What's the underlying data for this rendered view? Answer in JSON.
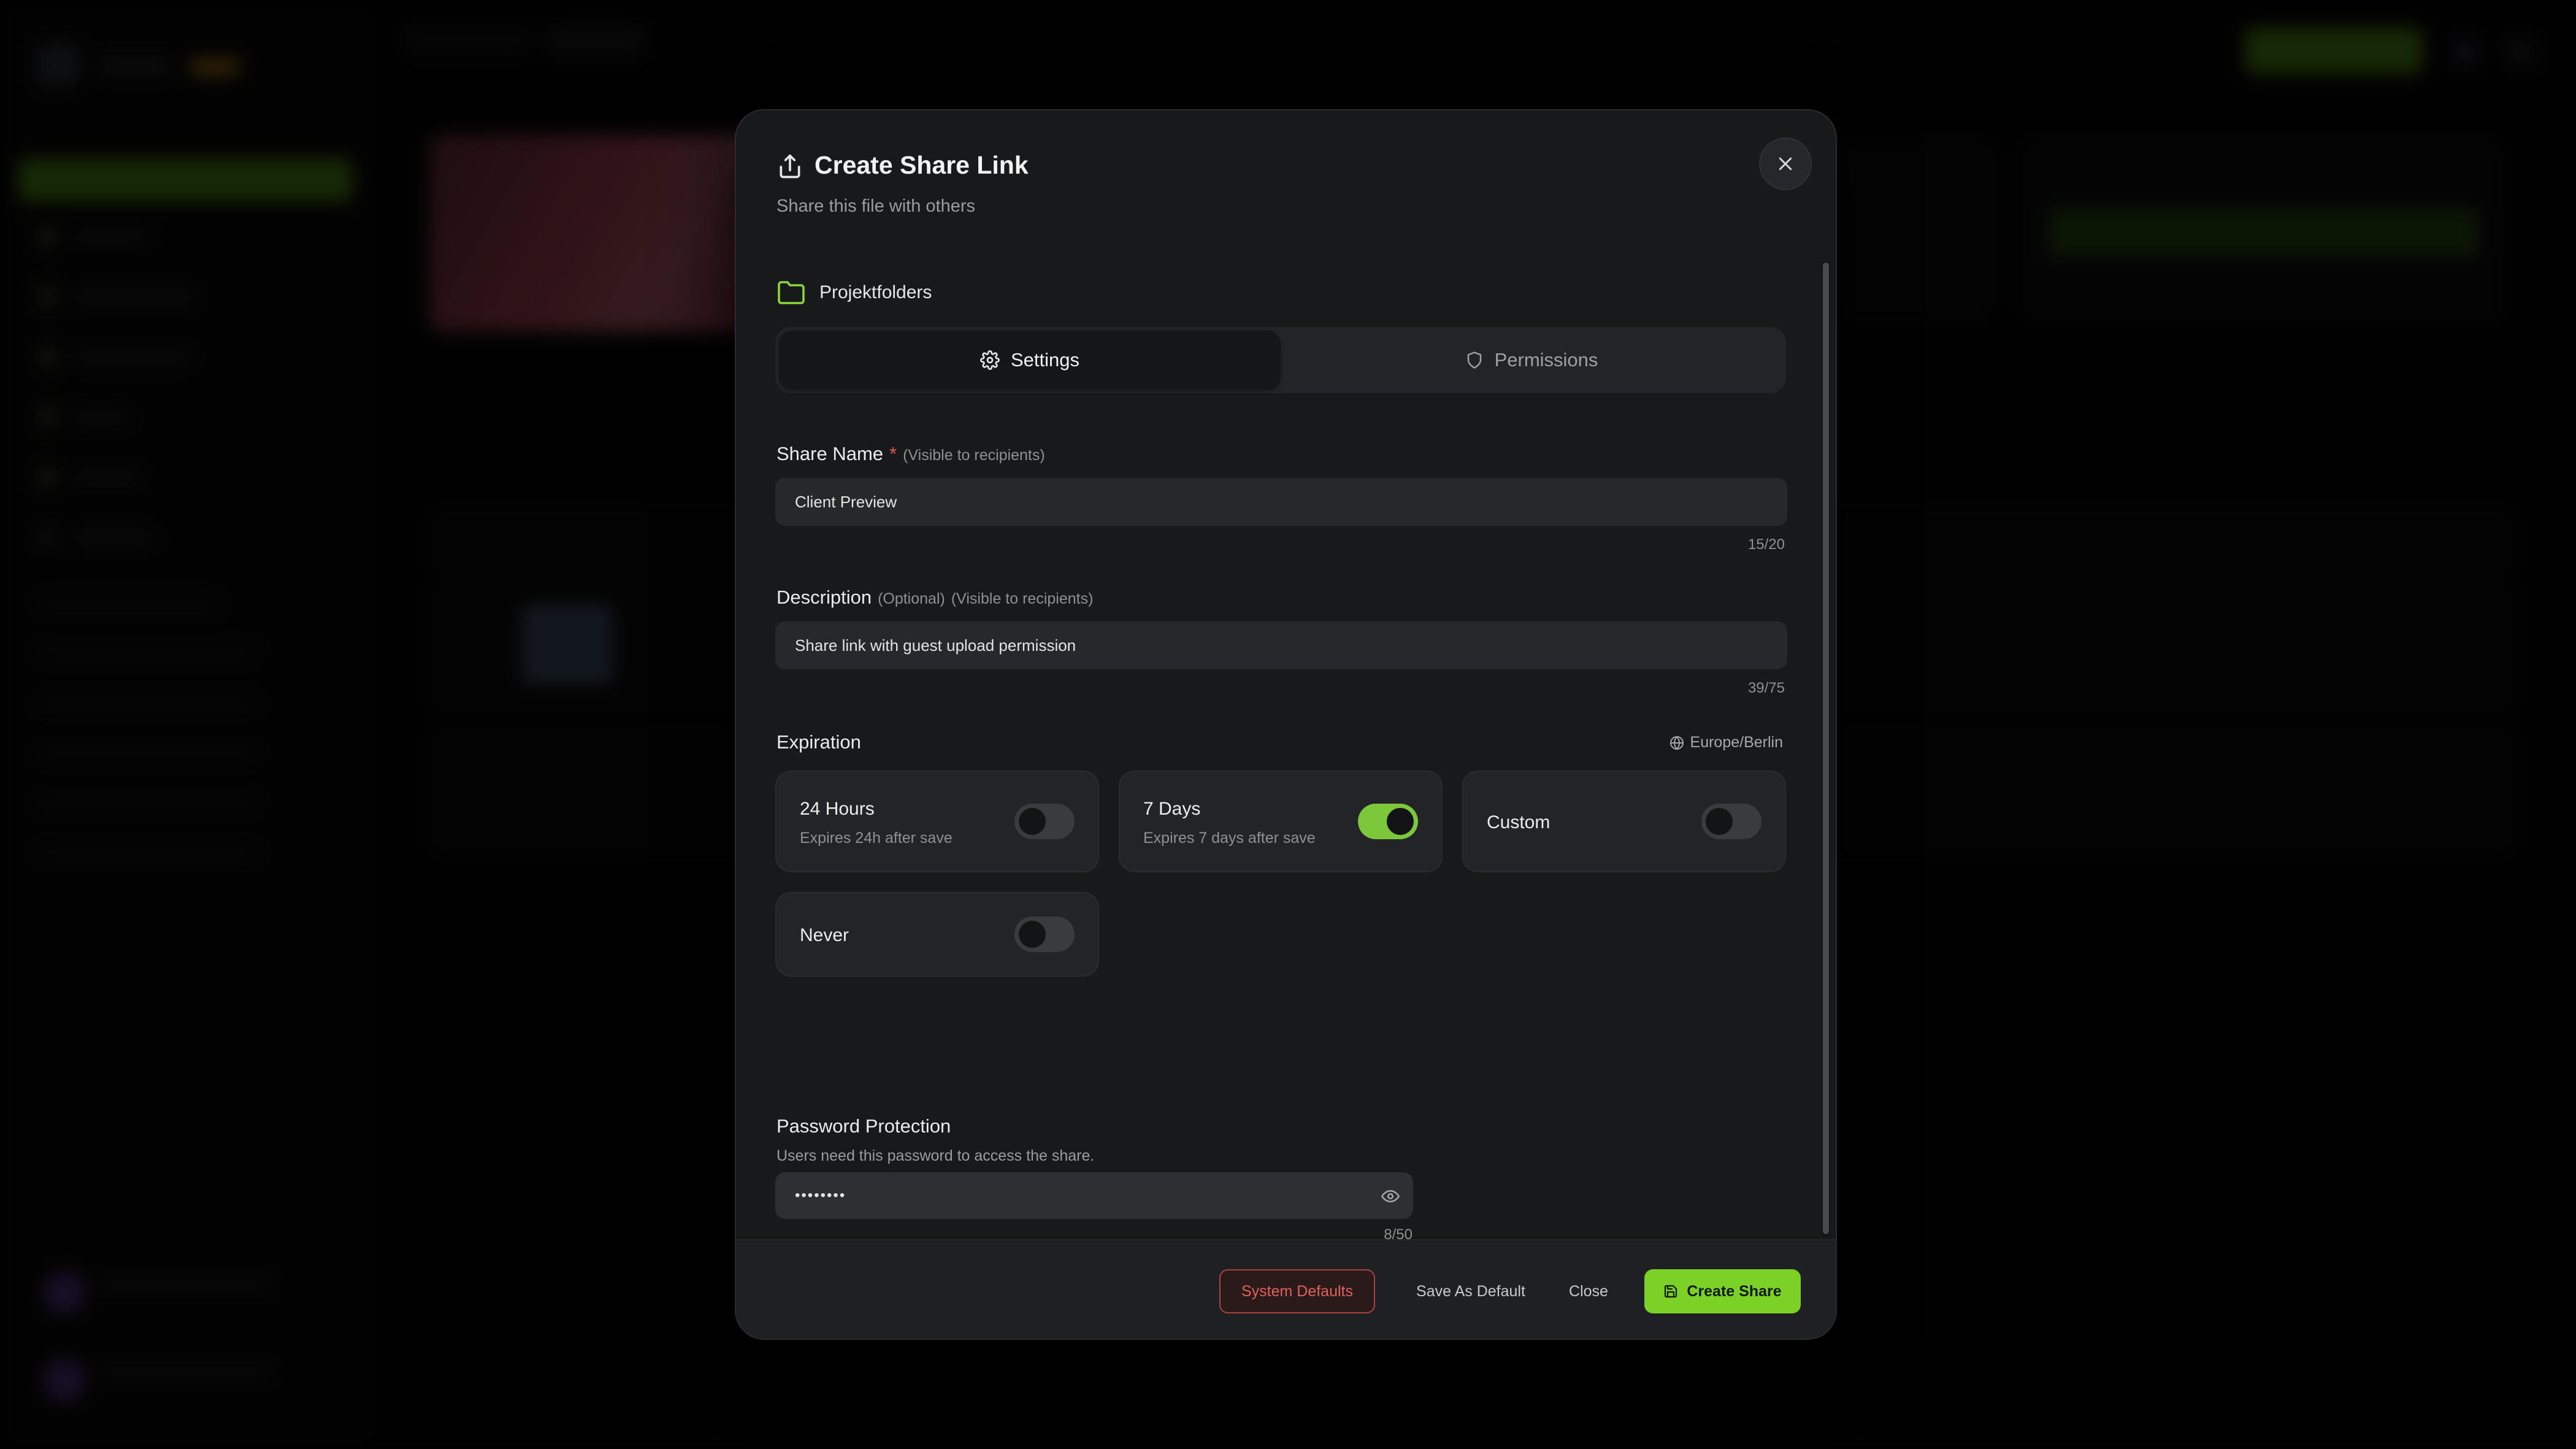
{
  "modal": {
    "title": "Create Share Link",
    "subtitle": "Share this file with others",
    "folder_name": "Projektfolders",
    "tabs": [
      {
        "label": "Settings",
        "icon": "gear-icon",
        "active": true
      },
      {
        "label": "Permissions",
        "icon": "shield-icon",
        "active": false
      }
    ],
    "share_name": {
      "label": "Share Name",
      "required_mark": "*",
      "hint": "(Visible to recipients)",
      "value": "Client Preview",
      "counter": "15/20"
    },
    "description": {
      "label": "Description",
      "optional": "(Optional)",
      "hint": "(Visible to recipients)",
      "value": "Share link with guest upload permission",
      "counter": "39/75"
    },
    "expiration": {
      "label": "Expiration",
      "timezone": "Europe/Berlin",
      "options": [
        {
          "title": "24 Hours",
          "desc": "Expires 24h after save",
          "enabled": false
        },
        {
          "title": "7 Days",
          "desc": "Expires 7 days after save",
          "enabled": true
        },
        {
          "title": "Custom",
          "desc": "",
          "enabled": false
        },
        {
          "title": "Never",
          "desc": "",
          "enabled": false
        }
      ]
    },
    "password": {
      "label": "Password Protection",
      "desc": "Users need this password to access the share.",
      "masked_value": "••••••••",
      "counter": "8/50"
    },
    "footer": {
      "system_defaults": "System Defaults",
      "save_as_default": "Save As Default",
      "close": "Close",
      "create_share": "Create Share"
    }
  },
  "colors": {
    "accent": "#7cd126",
    "danger": "#e0625a",
    "modal_bg": "#18191b"
  }
}
